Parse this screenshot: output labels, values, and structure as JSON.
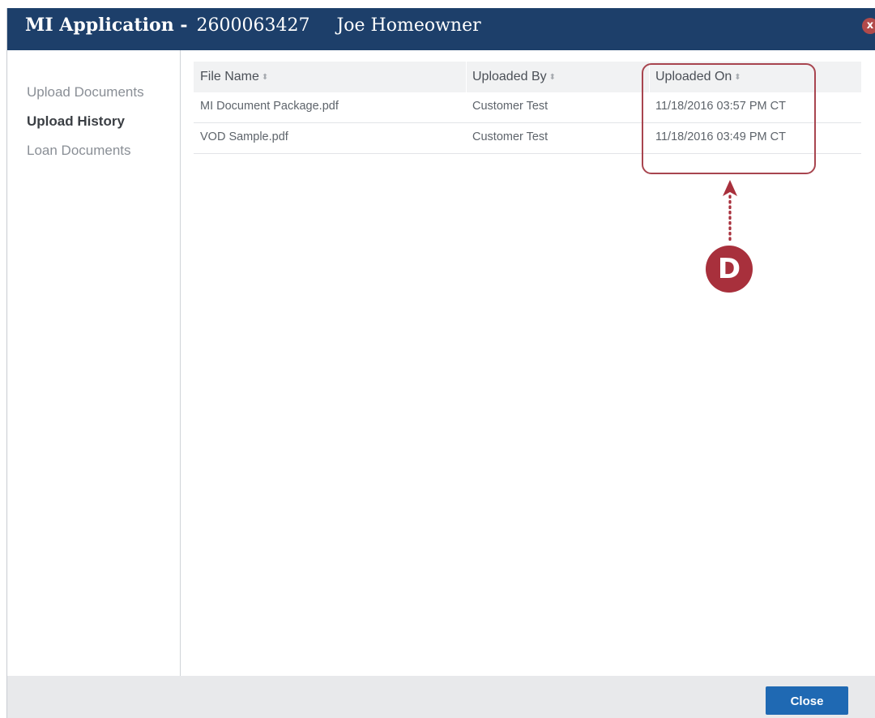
{
  "window": {
    "title_app": "MI Application -",
    "title_number": "2600063427",
    "title_name": "Joe Homeowner",
    "close_glyph": "x"
  },
  "sidebar": {
    "items": [
      {
        "label": "Upload Documents",
        "active": false
      },
      {
        "label": "Upload History",
        "active": true
      },
      {
        "label": "Loan Documents",
        "active": false
      }
    ]
  },
  "table": {
    "columns": [
      {
        "label": "File Name",
        "sort_icon": "sort-icon"
      },
      {
        "label": "Uploaded By",
        "sort_icon": "sort-icon"
      },
      {
        "label": "Uploaded On",
        "sort_icon": "sort-icon"
      }
    ],
    "rows": [
      [
        "MI Document Package.pdf",
        "Customer Test",
        "11/18/2016 03:57 PM CT"
      ],
      [
        "VOD Sample.pdf",
        "Customer Test",
        "11/18/2016 03:49 PM CT"
      ]
    ]
  },
  "annotation": {
    "label": "D",
    "color": "#a8303c"
  },
  "footer": {
    "close_label": "Close"
  },
  "colors": {
    "titlebar": "#1d3f6a",
    "primary_button": "#1f69b3"
  }
}
